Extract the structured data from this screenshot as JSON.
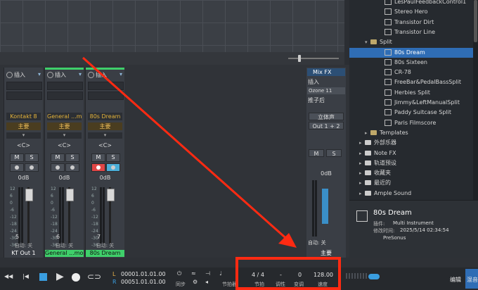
{
  "strips": [
    {
      "insert": "插入",
      "name": "Kontakt 8",
      "main": "主要",
      "pan": "<C>",
      "mute": "M",
      "solo": "S",
      "db": "0dB",
      "number": "5",
      "auto": "自动: 关",
      "output": "KT Out 1",
      "topcolor": "#3a3e45",
      "outcolor": "#3a3e45"
    },
    {
      "insert": "插入",
      "name": "General ...mond",
      "main": "主要",
      "pan": "<C>",
      "mute": "M",
      "solo": "S",
      "db": "0dB",
      "number": "6",
      "auto": "自动: 关",
      "output": "General ...mond",
      "topcolor": "#3fcf6a",
      "outcolor": "#3fcf6a"
    },
    {
      "insert": "插入",
      "name": "80s Dream",
      "main": "主要",
      "pan": "<C>",
      "mute": "M",
      "solo": "S",
      "db": "0dB",
      "number": "7",
      "auto": "自动: 关",
      "output": "80s Dream",
      "topcolor": "#3fcf6a",
      "outcolor": "#3fcf6a"
    }
  ],
  "meter_scale": [
    "12",
    "6",
    "0",
    "-6",
    "-12",
    "-18",
    "-24",
    "-30",
    "-36",
    "-42"
  ],
  "master": {
    "mixfx": "Mix FX",
    "insert": "插入",
    "plugin": "Ozone 11",
    "post": "推子后",
    "listen": "立体声",
    "output": "Out 1 + 2",
    "mute": "M",
    "solo": "S",
    "db": "0dB",
    "auto": "自动: 关",
    "label": "主要"
  },
  "browser": {
    "items": [
      {
        "label": "LesPaulFeedbackControl1",
        "type": "preset",
        "indent": 1,
        "selected": false
      },
      {
        "label": "Stereo Hero",
        "type": "preset",
        "indent": 1,
        "selected": false
      },
      {
        "label": "Transistor Dirt",
        "type": "preset",
        "indent": 1,
        "selected": false
      },
      {
        "label": "Transistor Line",
        "type": "preset",
        "indent": 1,
        "selected": false
      },
      {
        "label": "Split",
        "type": "folder-open",
        "indent": 0,
        "selected": false
      },
      {
        "label": "80s Dream",
        "type": "preset",
        "indent": 1,
        "selected": true
      },
      {
        "label": "80s Sixteen",
        "type": "preset",
        "indent": 1,
        "selected": false
      },
      {
        "label": "CR-78",
        "type": "preset",
        "indent": 1,
        "selected": false
      },
      {
        "label": "FreeBar&PedalBassSplit",
        "type": "preset",
        "indent": 1,
        "selected": false
      },
      {
        "label": "Herbies Split",
        "type": "preset",
        "indent": 1,
        "selected": false
      },
      {
        "label": "Jimmy&LeftManualSplit",
        "type": "preset",
        "indent": 1,
        "selected": false
      },
      {
        "label": "Paddy Suitcase Split",
        "type": "preset",
        "indent": 1,
        "selected": false
      },
      {
        "label": "Paris Filmscore",
        "type": "preset",
        "indent": 1,
        "selected": false
      },
      {
        "label": "Templates",
        "type": "folder",
        "indent": -1,
        "selected": false
      },
      {
        "label": "外部乐器",
        "type": "category",
        "indent": -2,
        "selected": false
      },
      {
        "label": "Note FX",
        "type": "category",
        "indent": -2,
        "selected": false
      },
      {
        "label": "轨道预设",
        "type": "category",
        "indent": -2,
        "selected": false
      },
      {
        "label": "收藏夹",
        "type": "category",
        "indent": -2,
        "selected": false
      },
      {
        "label": "最近的",
        "type": "category",
        "indent": -2,
        "selected": false
      },
      {
        "label": "Ample Sound",
        "type": "category",
        "indent": -2,
        "selected": false
      }
    ]
  },
  "info": {
    "title": "80s Dream",
    "plugin_label": "插件:",
    "plugin_value": "Multi Instrument",
    "modified_label": "修改时间:",
    "modified_value": "2025/5/14 02:34:54",
    "vendor": "PreSonus"
  },
  "transport": {
    "L_label": "L",
    "R_label": "R",
    "L_time": "00001.01.01.00",
    "R_time": "00051.01.01.00",
    "sync": "同步",
    "metronome": "节拍器",
    "timesig": "4 / 4",
    "timesig_label": "节拍",
    "key": "-",
    "key_label": "调性",
    "transpose": "0",
    "transpose_label": "变调",
    "tempo": "128.00",
    "tempo_label": "速度",
    "edit": "编辑",
    "mix": "混音"
  },
  "colors": {
    "annotation": "#ff2a12",
    "selection": "#2f6db5",
    "track_green": "#3fcf6a"
  }
}
